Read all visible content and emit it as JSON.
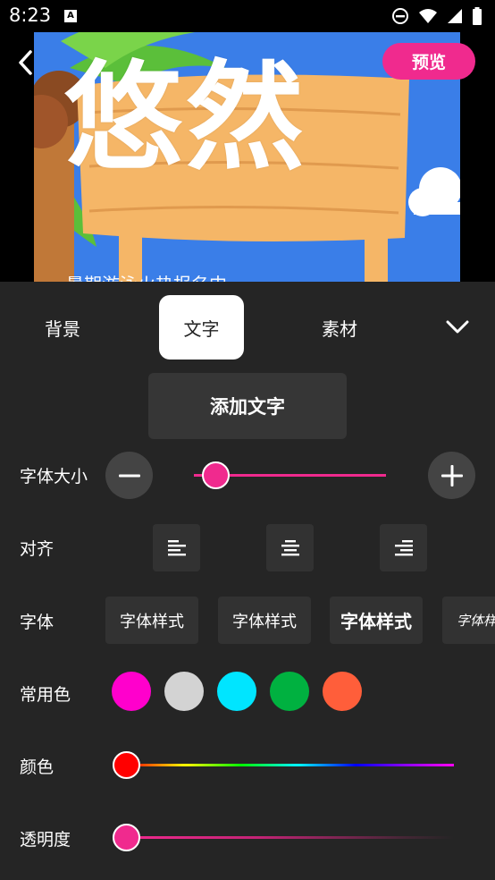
{
  "status_bar": {
    "time": "8:23",
    "notification_icon": "A"
  },
  "preview": {
    "preview_button": "预览",
    "poster_title": "悠然",
    "poster_subtitle": "暑期游泳火热报名中"
  },
  "tabs": [
    {
      "label": "背景",
      "active": false
    },
    {
      "label": "文字",
      "active": true
    },
    {
      "label": "素材",
      "active": false
    }
  ],
  "add_text_button": "添加文字",
  "font_size": {
    "label": "字体大小",
    "value_fraction": 0.11
  },
  "alignment": {
    "label": "对齐",
    "options": [
      "align-left-icon",
      "align-center-icon",
      "align-right-icon"
    ]
  },
  "font": {
    "label": "字体",
    "styles": [
      "字体样式",
      "字体样式",
      "字体样式",
      "字体样"
    ]
  },
  "common_colors": {
    "label": "常用色",
    "swatches": [
      "#ff00cc",
      "#d3d3d3",
      "#00e5ff",
      "#00b140",
      "#ff5e3a"
    ]
  },
  "color": {
    "label": "颜色",
    "selected": "#ff0000",
    "value_fraction": 0.0
  },
  "opacity": {
    "label": "透明度",
    "selected": "#f02a8e",
    "value_fraction": 0.0
  }
}
